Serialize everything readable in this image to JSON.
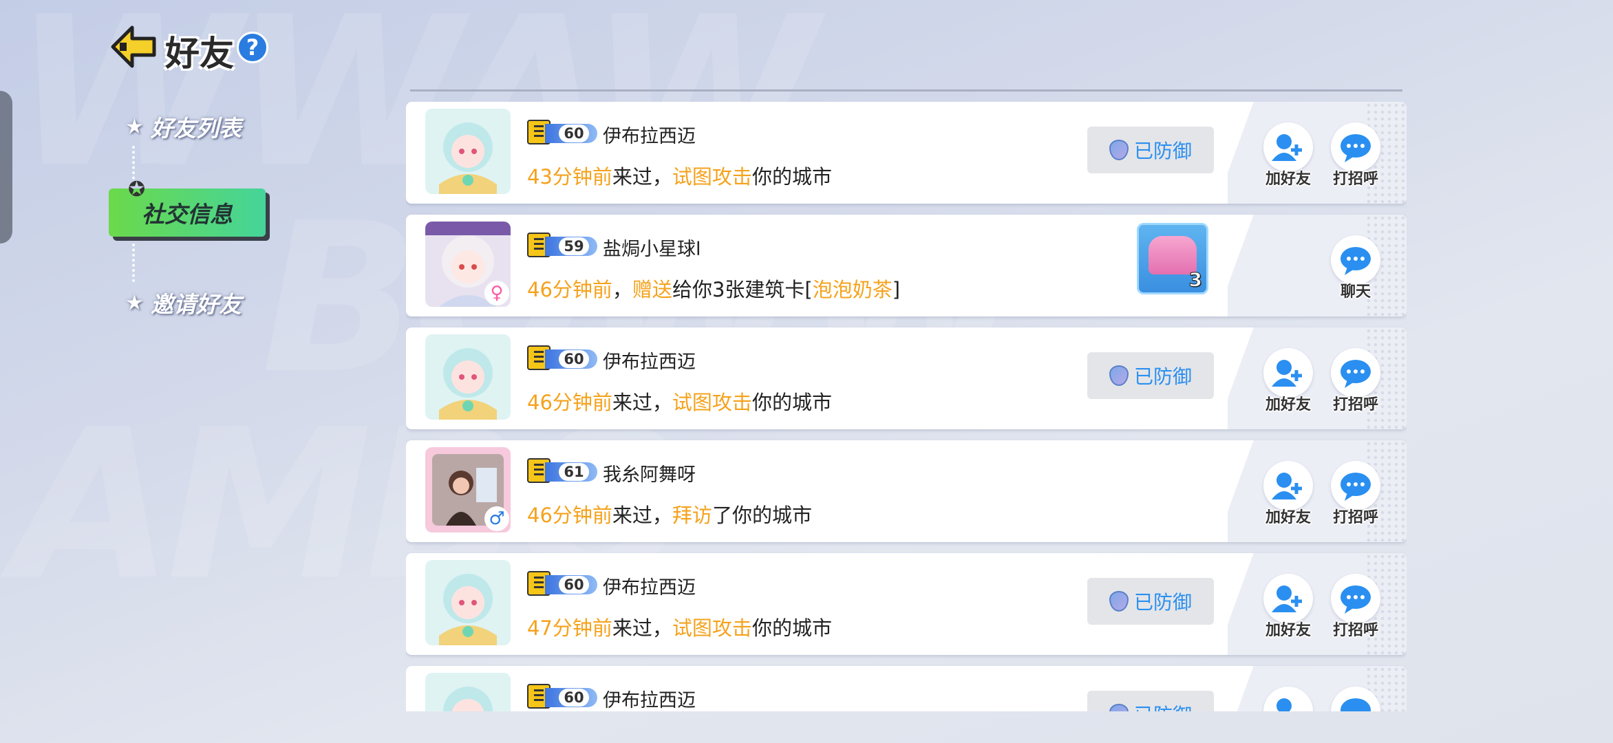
{
  "header": {
    "title": "好友",
    "help": "?"
  },
  "sidebar": {
    "items": [
      {
        "label": "好友列表"
      },
      {
        "label": "社交信息"
      },
      {
        "label": "邀请好友"
      }
    ]
  },
  "colors": {
    "highlight": "#f5a21c",
    "defended_text": "#2a8ff0",
    "active_tab": "#6bd94a"
  },
  "feed": [
    {
      "level": "60",
      "name": "伊布拉西迈",
      "parts": [
        "43分钟前",
        "来过，",
        "试图攻击",
        "你的城市"
      ],
      "status": "已防御",
      "actions": [
        "加好友",
        "打招呼"
      ],
      "avatar": "anime-girl-teal"
    },
    {
      "level": "59",
      "name": "盐焗小星球l",
      "parts": [
        "46分钟前",
        "，",
        "赠送",
        "给你3张建筑卡[",
        "泡泡奶茶",
        "]"
      ],
      "gender": "♀",
      "gift_count": "3",
      "actions": [
        "聊天"
      ],
      "avatar": "anime-girl-white"
    },
    {
      "level": "60",
      "name": "伊布拉西迈",
      "parts": [
        "46分钟前",
        "来过，",
        "试图攻击",
        "你的城市"
      ],
      "status": "已防御",
      "actions": [
        "加好友",
        "打招呼"
      ],
      "avatar": "anime-girl-teal"
    },
    {
      "level": "61",
      "name": "我糸阿舞呀",
      "parts": [
        "46分钟前",
        "来过，",
        "拜访",
        "了你的城市"
      ],
      "gender": "♂",
      "actions": [
        "加好友",
        "打招呼"
      ],
      "avatar": "photo"
    },
    {
      "level": "60",
      "name": "伊布拉西迈",
      "parts": [
        "47分钟前",
        "来过，",
        "试图攻击",
        "你的城市"
      ],
      "status": "已防御",
      "actions": [
        "加好友",
        "打招呼"
      ],
      "avatar": "anime-girl-teal"
    },
    {
      "level": "60",
      "name": "伊布拉西迈",
      "parts": [],
      "status": "已防御",
      "actions": [
        "",
        ""
      ],
      "avatar": "anime-girl-teal"
    }
  ]
}
